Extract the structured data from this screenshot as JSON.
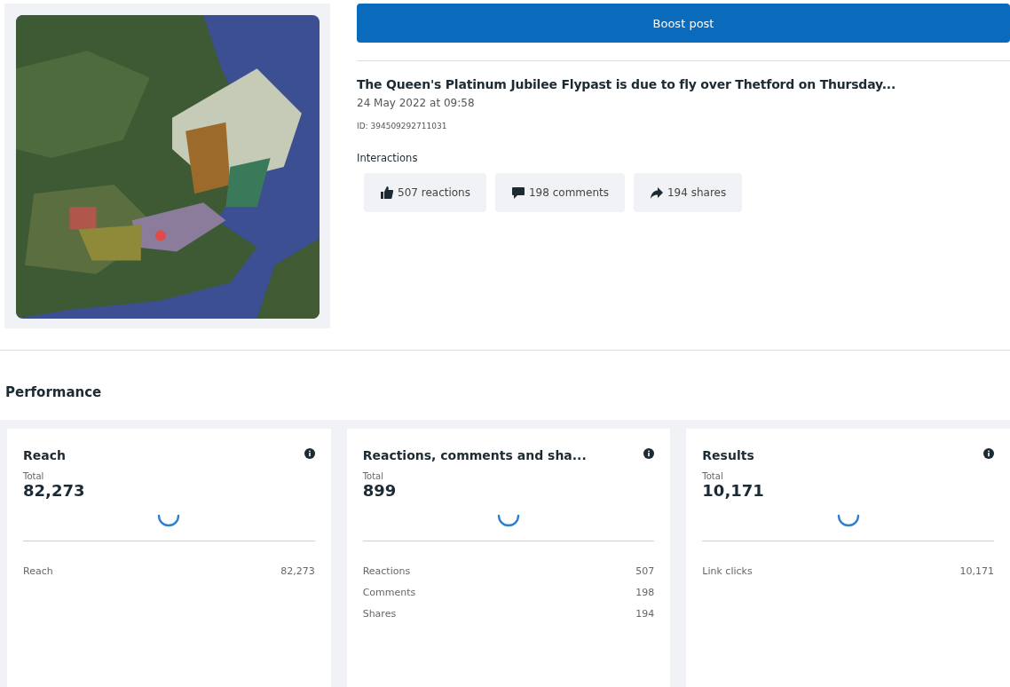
{
  "post": {
    "boost_button": "Boost post",
    "title": "The Queen's Platinum Jubilee Flypast is due to fly over Thetford on Thursday...",
    "date": "24 May 2022 at 09:58",
    "id": "ID: 394509292711031",
    "interactions_label": "Interactions",
    "interactions": [
      {
        "kind": "reactions",
        "label": "507 reactions"
      },
      {
        "kind": "comments",
        "label": "198 comments"
      },
      {
        "kind": "shares",
        "label": "194 shares"
      }
    ]
  },
  "performance": {
    "heading": "Performance",
    "cards": [
      {
        "title": "Reach",
        "total_label": "Total",
        "total": "82,273",
        "rows": [
          {
            "label": "Reach",
            "value": "82,273"
          }
        ]
      },
      {
        "title": "Reactions, comments and sha...",
        "total_label": "Total",
        "total": "899",
        "rows": [
          {
            "label": "Reactions",
            "value": "507"
          },
          {
            "label": "Comments",
            "value": "198"
          },
          {
            "label": "Shares",
            "value": "194"
          }
        ]
      },
      {
        "title": "Results",
        "total_label": "Total",
        "total": "10,171",
        "rows": [
          {
            "label": "Link clicks",
            "value": "10,171"
          }
        ]
      }
    ]
  }
}
